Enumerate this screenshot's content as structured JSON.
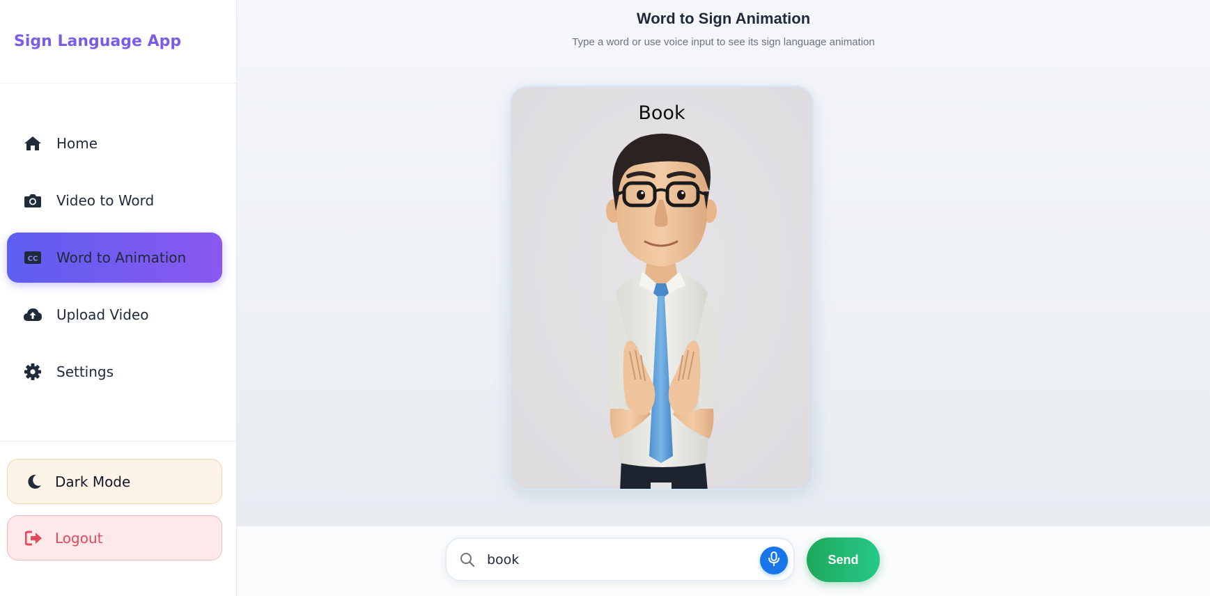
{
  "app": {
    "title": "Sign Language App"
  },
  "sidebar": {
    "items": [
      {
        "label": "Home",
        "icon": "home-icon",
        "active": false
      },
      {
        "label": "Video to Word",
        "icon": "camera-icon",
        "active": false
      },
      {
        "label": "Word to Animation",
        "icon": "cc-icon",
        "active": true
      },
      {
        "label": "Upload Video",
        "icon": "cloud-upload-icon",
        "active": false
      },
      {
        "label": "Settings",
        "icon": "gear-icon",
        "active": false
      }
    ],
    "dark_mode_label": "Dark Mode",
    "logout_label": "Logout"
  },
  "main": {
    "title": "Word to Sign Animation",
    "subtitle": "Type a word or use voice input to see its sign language animation",
    "animation_word": "Book"
  },
  "input": {
    "value": "book",
    "send_label": "Send"
  },
  "colors": {
    "brand": "#7c5ce6",
    "active_gradient_start": "#5d5ef0",
    "active_gradient_end": "#8a58f0",
    "send_green": "#1fa75a",
    "mic_blue": "#1877e8",
    "logout_red": "#e5485a"
  }
}
